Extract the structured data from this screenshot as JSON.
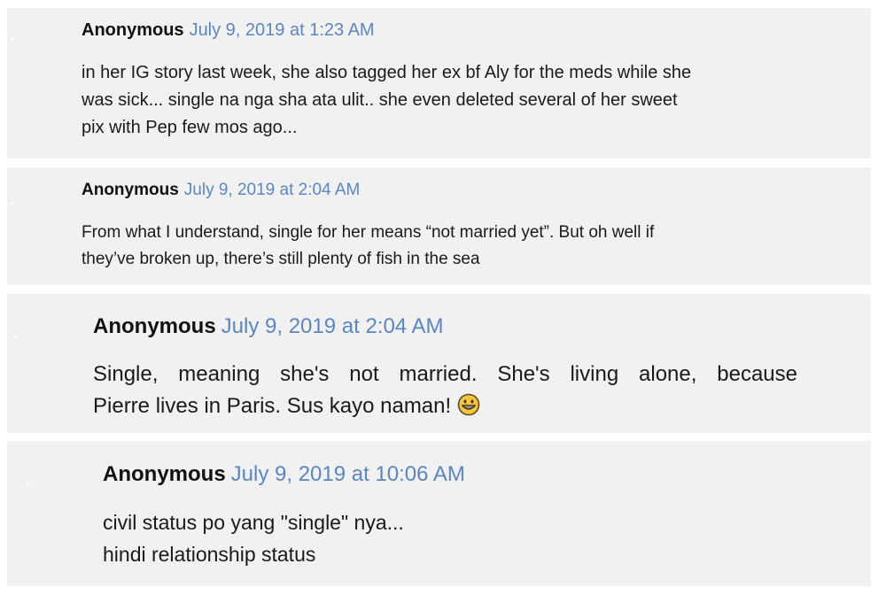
{
  "comments": [
    {
      "author": "Anonymous",
      "date": "July 9, 2019 at 1:23 AM",
      "lines": [
        "in her IG story last week, she also tagged her ex bf Aly for the meds while she",
        "was sick... single na nga sha ata ulit.. she even deleted several of her sweet",
        "pix with Pep few mos ago..."
      ]
    },
    {
      "author": "Anonymous",
      "date": "July 9, 2019 at 2:04 AM",
      "lines": [
        "From what I understand, single for her means “not married yet”. But oh well if",
        "they’ve broken up, there’s still plenty of fish in the sea"
      ]
    },
    {
      "author": "Anonymous",
      "date": "July 9, 2019 at 2:04 AM",
      "lines": [
        "Single, meaning she's not married. She's living alone, because",
        "Pierre lives in Paris. Sus kayo naman!"
      ],
      "emoji": "grinning-face-icon"
    },
    {
      "author": "Anonymous",
      "date": "July 9, 2019 at 10:06 AM",
      "lines": [
        "civil status po yang \"single\" nya...",
        "hindi relationship status"
      ]
    }
  ],
  "colors": {
    "card_bg": "#f1f1f1",
    "date_link": "#5b86c2",
    "text": "#1a1a1a"
  }
}
